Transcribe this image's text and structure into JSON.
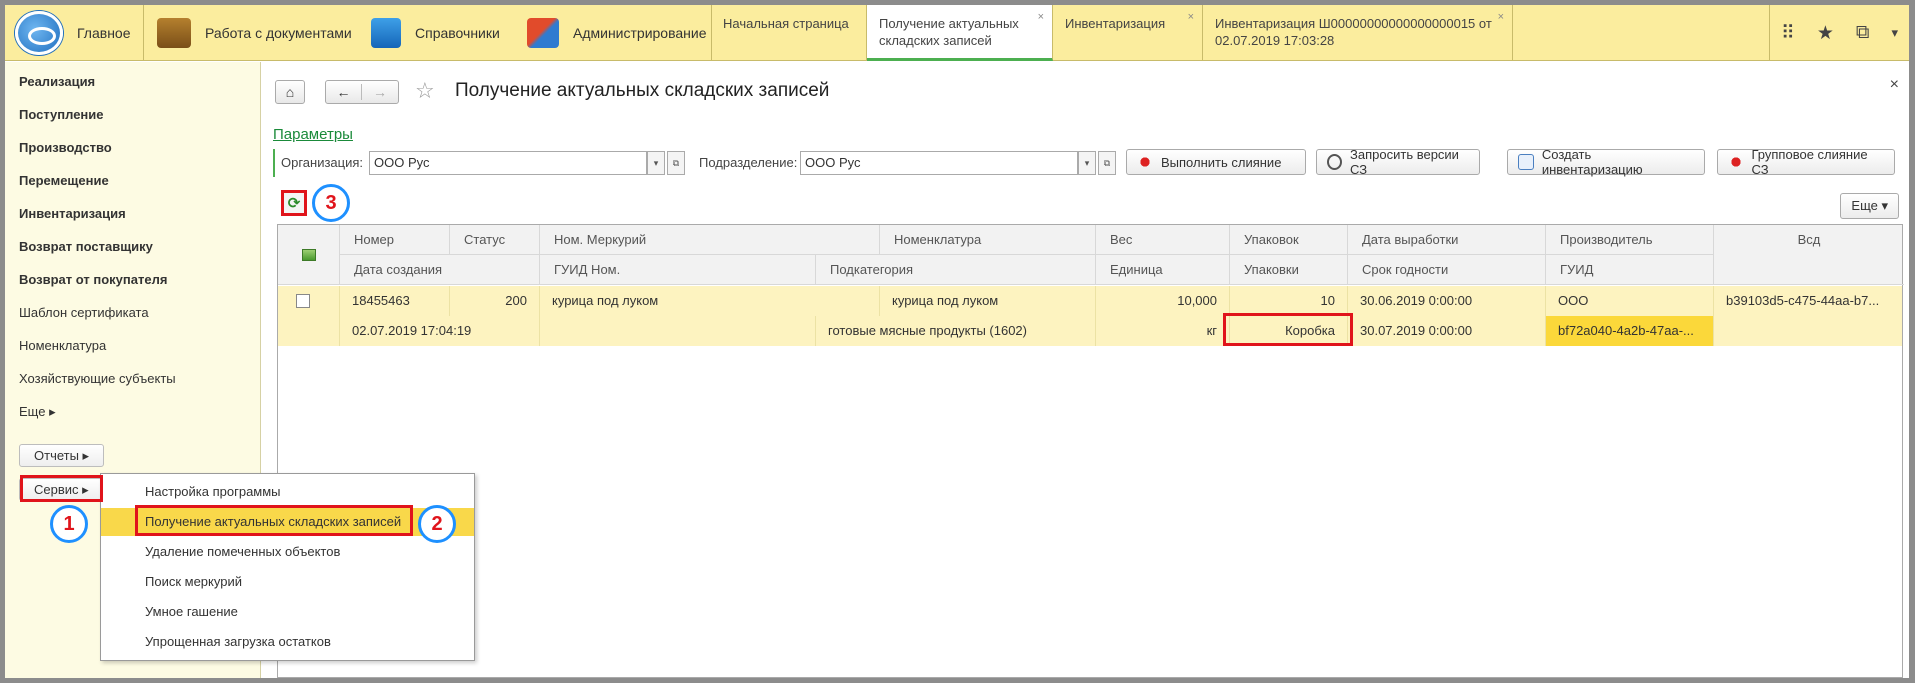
{
  "topbar": {
    "sections": [
      {
        "label": "Главное"
      },
      {
        "label": "Работа с документами"
      },
      {
        "label": "Справочники"
      },
      {
        "label": "Администрирование"
      }
    ],
    "tabs": [
      {
        "label": "Начальная страница"
      },
      {
        "label": "Получение актуальных складских записей"
      },
      {
        "label": "Инвентаризация"
      },
      {
        "label": "Инвентаризация Ш00000000000000000015 от 02.07.2019 17:03:28"
      }
    ],
    "close_glyph": "×"
  },
  "sidebar": {
    "items": [
      {
        "label": "Реализация"
      },
      {
        "label": "Поступление"
      },
      {
        "label": "Производство"
      },
      {
        "label": "Перемещение"
      },
      {
        "label": "Инвентаризация"
      },
      {
        "label": "Возврат поставщику"
      },
      {
        "label": "Возврат от покупателя"
      },
      {
        "label": "Шаблон сертификата"
      },
      {
        "label": "Номенклатура"
      },
      {
        "label": "Хозяйствующие субъекты"
      },
      {
        "label": "Еще ▸"
      }
    ],
    "reports_label": "Отчеты ▸",
    "service_label": "Сервис ▸"
  },
  "menu": {
    "items": [
      {
        "label": "Настройка программы"
      },
      {
        "label": "Получение актуальных складских записей"
      },
      {
        "label": "Удаление помеченных объектов"
      },
      {
        "label": "Поиск меркурий"
      },
      {
        "label": "Умное гашение"
      },
      {
        "label": "Упрощенная загрузка остатков"
      }
    ]
  },
  "page": {
    "title": "Получение актуальных складских записей",
    "params_link": "Параметры",
    "org_label": "Организация:",
    "org_value": "ООО Рус",
    "dept_label": "Подразделение:",
    "dept_value": "ООО Рус",
    "buttons": {
      "merge": "Выполнить слияние",
      "request_versions": "Запросить версии СЗ",
      "create_inventory": "Создать инвентаризацию",
      "group_merge": "Групповое слияние СЗ"
    },
    "more": "Еще ▾"
  },
  "callouts": [
    "1",
    "2",
    "3"
  ],
  "table": {
    "header_top": [
      "Номер",
      "Статус",
      "Ном. Меркурий",
      "Номенклатура",
      "Вес",
      "Упаковок",
      "Дата выработки",
      "Производитель",
      "Всд"
    ],
    "header_bottom": [
      "Дата создания",
      "ГУИД Ном.",
      "Подкатегория",
      "Единица",
      "Упаковки",
      "Срок годности",
      "ГУИД"
    ],
    "rows": [
      {
        "number": "18455463",
        "status": "200",
        "merc_nom": "курица под луком",
        "nomenclature": "курица под луком",
        "weight": "10,000",
        "packs": "10",
        "prod_date": "30.06.2019 0:00:00",
        "producer": "ООО",
        "vsd": "b39103d5-c475-44aa-b7...",
        "created": "02.07.2019 17:04:19",
        "guid_nom": "",
        "subcategory": "готовые мясные продукты (1602)",
        "unit": "кг",
        "pack_type": "Коробка",
        "expiry": "30.07.2019 0:00:00",
        "guid": "bf72a040-4a2b-47aa-..."
      }
    ]
  },
  "colors": {
    "topbar": "#fbed9e",
    "sidebar": "#fdfbe3",
    "highlight": "#f9d84a",
    "row": "#fdf3c0",
    "accent_red": "#e0141b",
    "accent_blue": "#1e90ff",
    "link_green": "#1a8a3a"
  }
}
